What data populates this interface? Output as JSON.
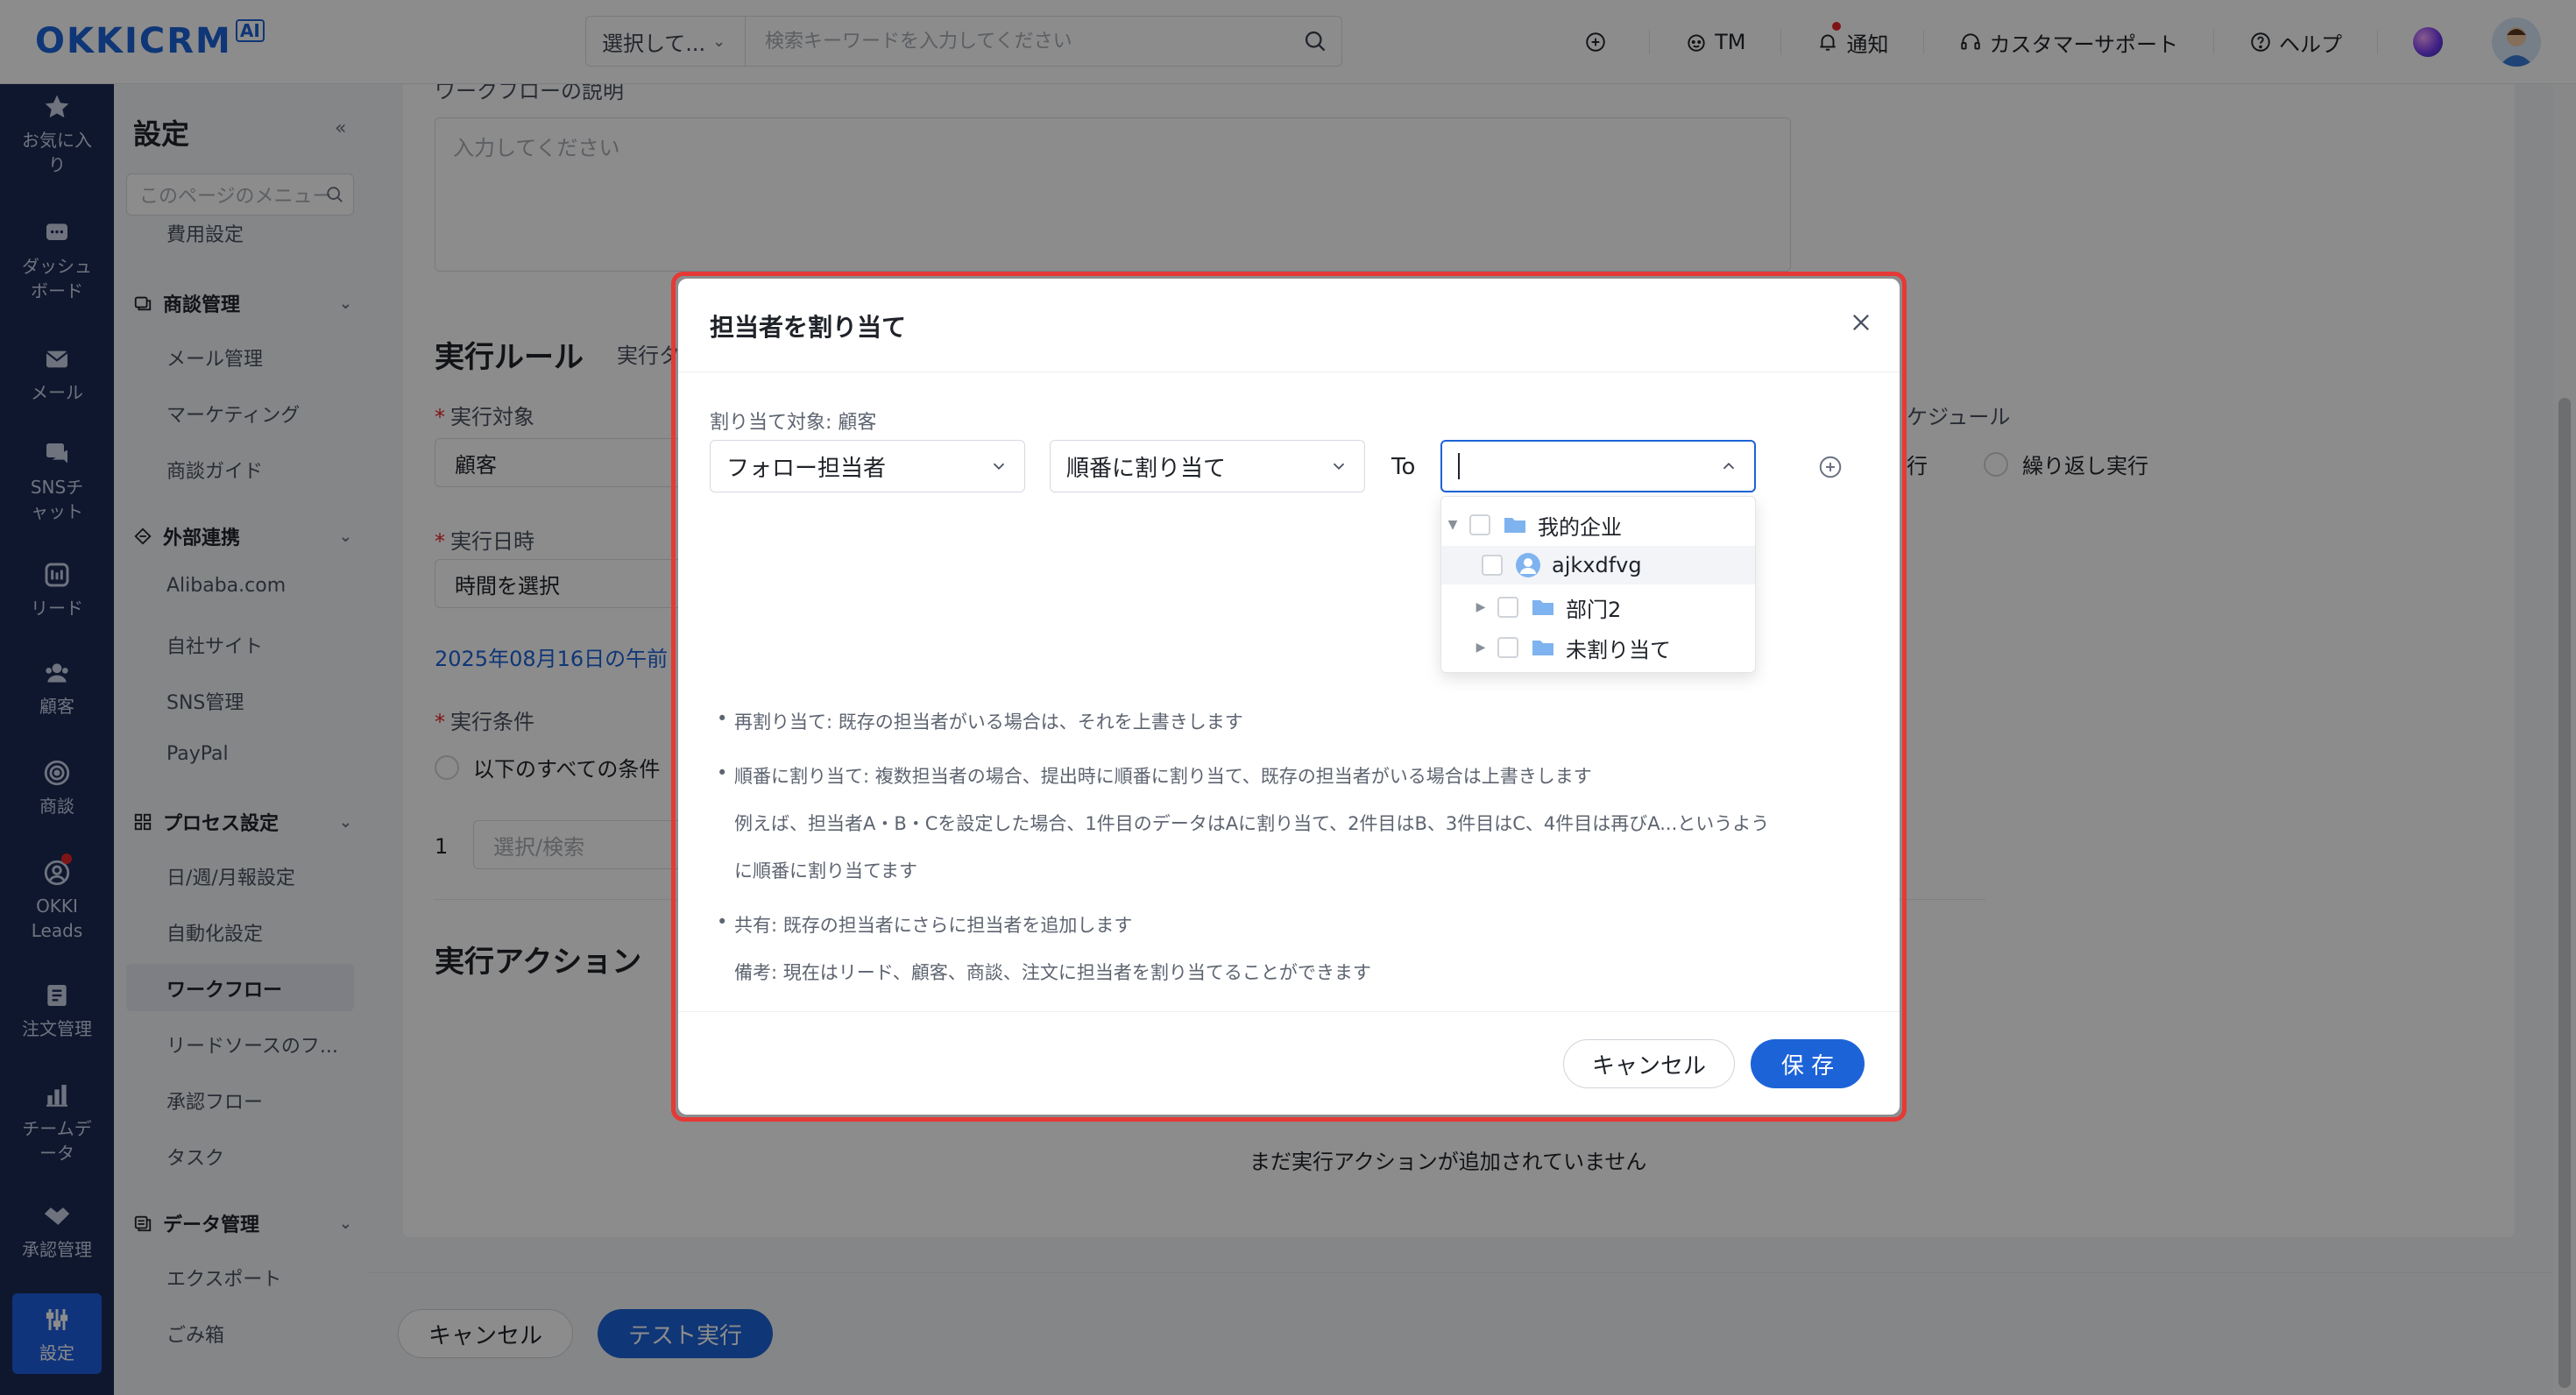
{
  "topbar": {
    "logo_text": "OKKICRM",
    "logo_badge": "AI",
    "search_select": "選択して...",
    "search_placeholder": "検索キーワードを入力してください",
    "tm_label": "TM",
    "notify_label": "通知",
    "support_label": "カスタマーサポート",
    "help_label": "ヘルプ"
  },
  "leftnav": {
    "items": [
      {
        "label": "お気に入り",
        "icon": "star-icon"
      },
      {
        "label": "ダッシュボード",
        "icon": "dashboard-icon"
      },
      {
        "label": "メール",
        "icon": "mail-icon"
      },
      {
        "label": "SNSチャット",
        "icon": "chat-icon"
      },
      {
        "label": "リード",
        "icon": "lead-icon"
      },
      {
        "label": "顧客",
        "icon": "customer-icon"
      },
      {
        "label": "商談",
        "icon": "target-icon"
      },
      {
        "label": "OKKI Leads",
        "icon": "okki-leads-icon"
      },
      {
        "label": "注文管理",
        "icon": "order-icon"
      },
      {
        "label": "チームデータ",
        "icon": "bar-chart-icon"
      },
      {
        "label": "承認管理",
        "icon": "handshake-icon"
      },
      {
        "label": "設定",
        "icon": "settings-sliders-icon"
      }
    ]
  },
  "submenu": {
    "title": "設定",
    "search_placeholder": "このページのメニュー",
    "item_cost": "費用設定",
    "group_deal": "商談管理",
    "item_mail_mgmt": "メール管理",
    "item_marketing": "マーケティング",
    "item_deal_guide": "商談ガイド",
    "group_external": "外部連携",
    "item_alibaba": "Alibaba.com",
    "item_own_site": "自社サイト",
    "item_sns_mgmt": "SNS管理",
    "item_paypal": "PayPal",
    "group_process": "プロセス設定",
    "item_report": "日/週/月報設定",
    "item_automation": "自動化設定",
    "item_workflow": "ワークフロー",
    "item_lead_source": "リードソースのフ...",
    "item_approval_flow": "承認フロー",
    "item_task": "タスク",
    "group_data": "データ管理",
    "item_export": "エクスポート",
    "item_trash": "ごみ箱"
  },
  "main": {
    "desc_label": "ワークフローの説明",
    "desc_placeholder": "入力してください",
    "rule_title": "実行ルール",
    "rule_sub": "実行タ",
    "target_label": "実行対象",
    "target_value": "顧客",
    "schedule_label": "ケジュール",
    "radio_once": "行",
    "radio_repeat": "繰り返し実行",
    "datetime_label": "実行日時",
    "datetime_value": "時間を選択",
    "date_link": "2025年08月16日の午前",
    "condition_label": "実行条件",
    "condition_radio": "以下のすべての条件",
    "cond_index": "1",
    "cond_placeholder": "選択/検索",
    "action_title": "実行アクション",
    "action_empty": "まだ実行アクションが追加されていません",
    "cancel_btn": "キャンセル",
    "test_btn": "テスト実行"
  },
  "modal": {
    "title": "担当者を割り当て",
    "assign_target_label": "割り当て対象: 顧客",
    "owner_select": "フォロー担当者",
    "method_select": "順番に割り当て",
    "to_label": "To",
    "picker_value": "",
    "tree": [
      {
        "label": "我的企业",
        "type": "folder",
        "level": 0,
        "expanded": true
      },
      {
        "label": "ajkxdfvg",
        "type": "user",
        "level": 1
      },
      {
        "label": "部门2",
        "type": "folder",
        "level": 1,
        "expanded": false
      },
      {
        "label": "未割り当て",
        "type": "folder",
        "level": 1,
        "expanded": false
      }
    ],
    "notes": {
      "n1": "再割り当て: 既存の担当者がいる場合は、それを上書きします",
      "n2": "順番に割り当て: 複数担当者の場合、提出時に順番に割り当て、既存の担当者がいる場合は上書きします",
      "n2b": "例えば、担当者A・B・Cを設定した場合、1件目のデータはAに割り当て、2件目はB、3件目はC、4件目は再びA...というよう",
      "n2c": "に順番に割り当てます",
      "n3": "共有: 既存の担当者にさらに担当者を追加します",
      "n3b": "備考: 現在はリード、顧客、商談、注文に担当者を割り当てることができます"
    },
    "cancel_btn": "キャンセル",
    "save_btn": "保 存"
  },
  "colors": {
    "brand": "#1d63d8",
    "nav_bg": "#1a2a55",
    "highlight_border": "#e53935"
  }
}
